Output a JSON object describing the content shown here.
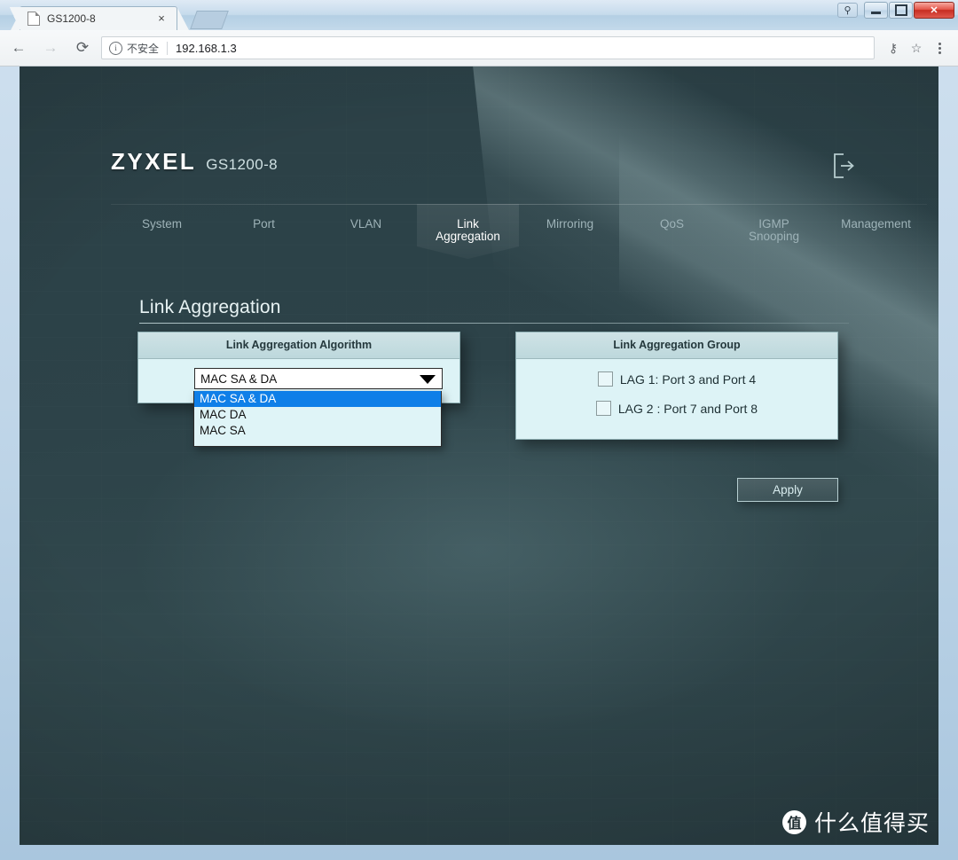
{
  "browser": {
    "tab_title": "GS1200-8",
    "tab_close": "×",
    "back_icon": "←",
    "forward_icon": "→",
    "reload_icon": "⟳",
    "security_label": "不安全",
    "url": "192.168.1.3",
    "key_icon": "⚷",
    "star_icon": "☆",
    "win_minimize": "–",
    "win_maximize": "□",
    "win_close": "✕",
    "win_person": "⚲"
  },
  "header": {
    "brand": "ZYXEL",
    "model": "GS1200-8",
    "logout_icon": "logout-icon"
  },
  "nav": {
    "tabs": [
      {
        "label": "System",
        "line2": "",
        "active": false
      },
      {
        "label": "Port",
        "line2": "",
        "active": false
      },
      {
        "label": "VLAN",
        "line2": "",
        "active": false
      },
      {
        "label": "Link",
        "line2": "Aggregation",
        "active": true
      },
      {
        "label": "Mirroring",
        "line2": "",
        "active": false
      },
      {
        "label": "QoS",
        "line2": "",
        "active": false
      },
      {
        "label": "IGMP",
        "line2": "Snooping",
        "active": false
      },
      {
        "label": "Management",
        "line2": "",
        "active": false
      }
    ]
  },
  "page": {
    "title": "Link Aggregation"
  },
  "algorithm_panel": {
    "header": "Link Aggregation Algorithm",
    "selected": "MAC SA & DA",
    "options": [
      {
        "label": "MAC SA & DA",
        "selected": true
      },
      {
        "label": "MAC DA",
        "selected": false
      },
      {
        "label": "MAC SA",
        "selected": false
      }
    ]
  },
  "group_panel": {
    "header": "Link Aggregation Group",
    "rows": [
      {
        "label": "LAG 1: Port 3 and Port 4",
        "checked": false
      },
      {
        "label": "LAG 2 : Port 7 and Port 8",
        "checked": false
      }
    ]
  },
  "actions": {
    "apply_label": "Apply"
  },
  "watermark": {
    "logo_char": "值",
    "text": "什么值得买"
  },
  "colors": {
    "page_bg": "#2b4046",
    "panel_head": "#cfe3e6",
    "panel_body": "#ddf3f6",
    "highlight": "#0f7fe8",
    "accent_text": "#e8f3f4",
    "close_button": "#c62d22"
  }
}
